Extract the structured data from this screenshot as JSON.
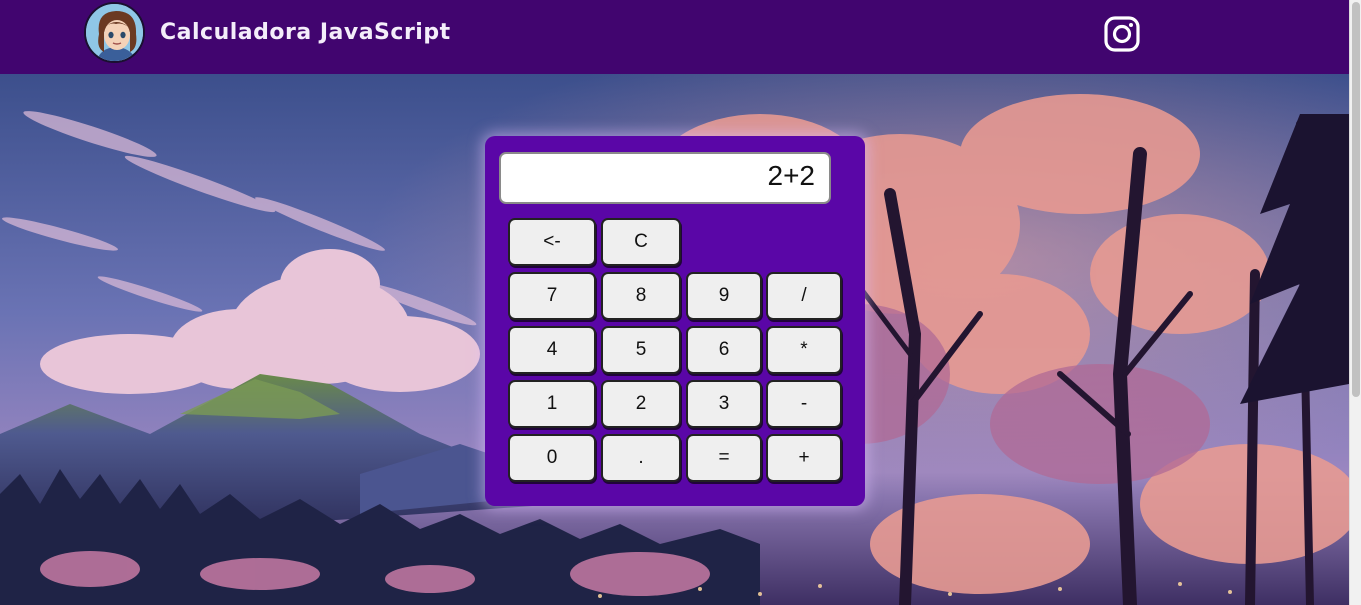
{
  "header": {
    "title": "Calculadora JavaScript"
  },
  "colors": {
    "header_bg": "#41056f",
    "calc_bg": "#5a06a7",
    "key_bg": "#efefef"
  },
  "icons": {
    "avatar": "user-avatar-illustration",
    "social": "instagram-icon"
  },
  "calculator": {
    "display_value": "2+2",
    "keys": {
      "backspace": "<-",
      "clear": "C",
      "k7": "7",
      "k8": "8",
      "k9": "9",
      "div": "/",
      "k4": "4",
      "k5": "5",
      "k6": "6",
      "mul": "*",
      "k1": "1",
      "k2": "2",
      "k3": "3",
      "sub": "-",
      "k0": "0",
      "dot": ".",
      "eq": "=",
      "add": "+"
    }
  }
}
